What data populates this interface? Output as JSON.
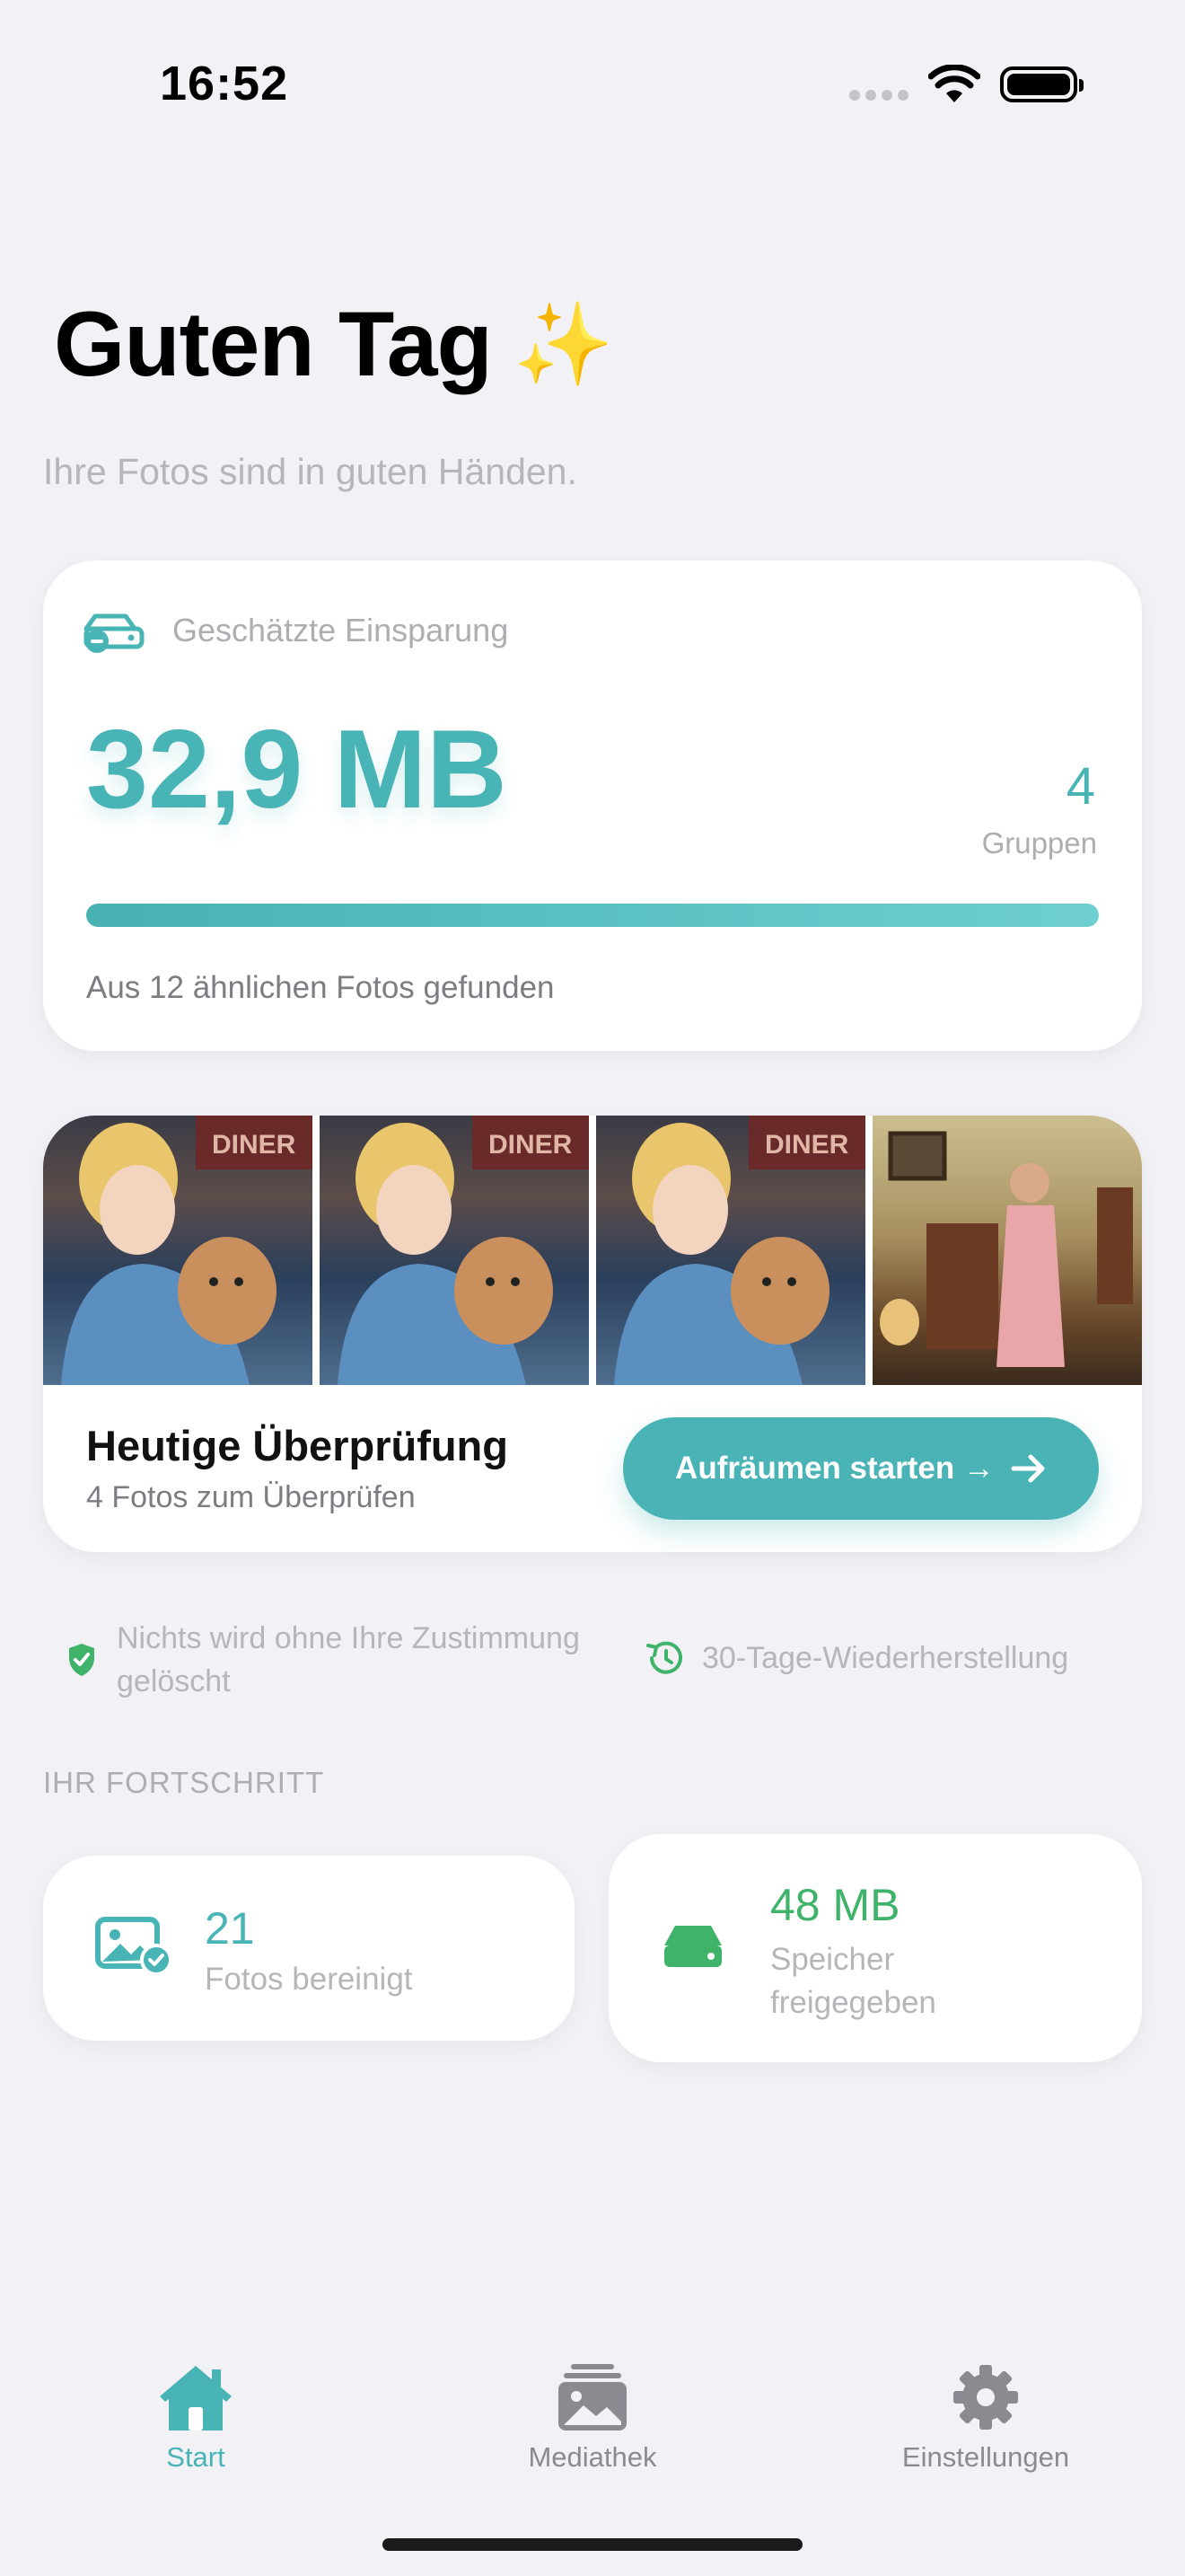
{
  "status_bar": {
    "time": "16:52",
    "icons": [
      "cellular-dots-icon",
      "wifi-icon",
      "battery-icon"
    ]
  },
  "header": {
    "greeting": "Guten Tag",
    "greeting_emoji": "✨",
    "subtitle": "Ihre Fotos sind in guten Händen."
  },
  "savings": {
    "icon": "storage-minus-icon",
    "label": "Geschätzte Einsparung",
    "value": "32,9 MB",
    "groups_count": "4",
    "groups_label": "Gruppen",
    "progress_fraction": 1.0,
    "found_text": "Aus 12 ähnlichen Fotos gefunden"
  },
  "review": {
    "thumbnails": [
      "girl-with-puppy-diner",
      "girl-with-puppy-diner",
      "girl-with-puppy-diner",
      "man-in-vintage-room"
    ],
    "title": "Heutige Überprüfung",
    "subtitle": "4 Fotos zum Überprüfen",
    "button_label": "Aufräumen starten →"
  },
  "info": {
    "left_text": "Nichts wird ohne Ihre Zustimmung gelöscht",
    "right_text": "30-Tage-Wiederherstellung"
  },
  "progress_section": {
    "header": "IHR FORTSCHRITT",
    "cleaned": {
      "value": "21",
      "label": "Fotos bereinigt"
    },
    "freed": {
      "value": "48 MB",
      "label": "Speicher freigegeben"
    }
  },
  "tabs": [
    {
      "label": "Start",
      "icon": "home-icon",
      "active": true
    },
    {
      "label": "Mediathek",
      "icon": "photo-library-icon",
      "active": false
    },
    {
      "label": "Einstellungen",
      "icon": "gear-icon",
      "active": false
    }
  ],
  "colors": {
    "accent": "#48b4b6",
    "green": "#3fb36a",
    "background": "#f2f1f6"
  }
}
